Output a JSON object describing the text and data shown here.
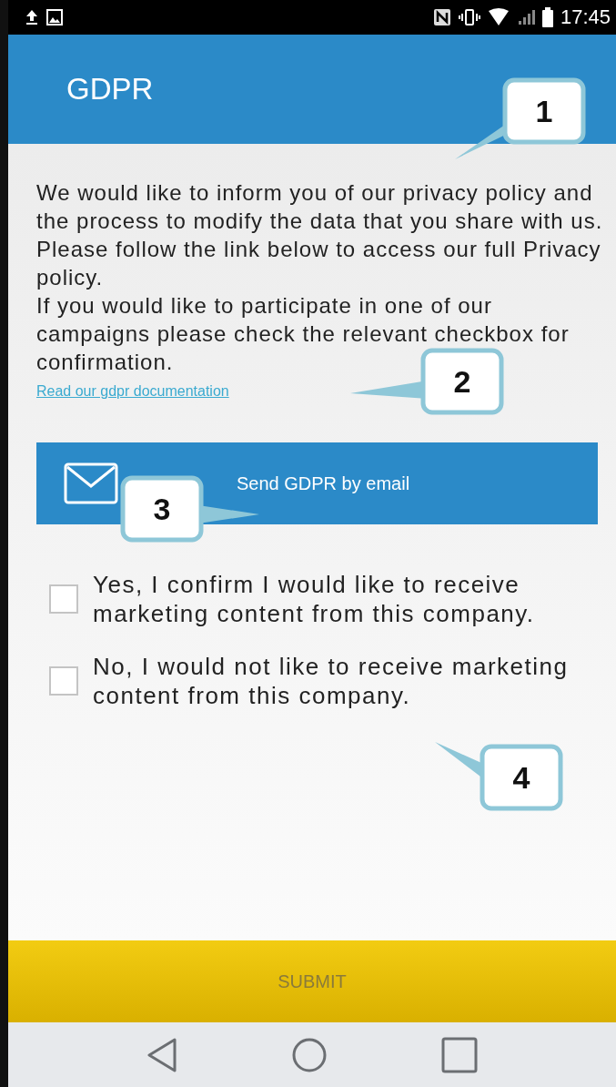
{
  "status_bar": {
    "time": "17:45"
  },
  "app_bar": {
    "title": "GDPR"
  },
  "intro": {
    "paragraphs": [
      "We would like to inform you of our privacy policy and the process to modify the data that you share with us. Please follow the link below to access our full Privacy policy.",
      "If you would like to participate in one of our campaigns please check the relevant checkbox for confirmation."
    ]
  },
  "link": "Read our gdpr documentation",
  "email_button": {
    "label": "Send GDPR by email"
  },
  "options": [
    {
      "label": "Yes, I confirm I would like to receive marketing content from this company.",
      "checked": false
    },
    {
      "label": "No, I would not like to receive marketing content from this company.",
      "checked": false
    }
  ],
  "submit_button": {
    "label": "SUBMIT"
  },
  "callouts": [
    "1",
    "2",
    "3",
    "4"
  ]
}
